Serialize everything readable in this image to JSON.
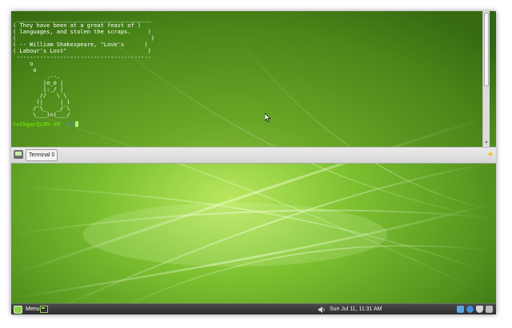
{
  "terminal": {
    "fortune_lines": [
      " ________________________________________",
      "( They have been at a great feast of )",
      "( languages, and stolen the scraps.     )",
      "(                                        )",
      "( -- William Shakespeare, \"Love's      )",
      "( Labour's Lost\"                        )",
      " ----------------------------------------",
      "     o",
      "      o",
      "          .--.",
      "         |o_o |",
      "         |:_/ |",
      "        //   \\ \\",
      "       (|     | )",
      "      /'\\_   _/`\\",
      "      \\___)=(___/"
    ],
    "prompt_user": "rothgar@LM9-VM",
    "prompt_path": " ~ $"
  },
  "tabbar": {
    "tab_label": "Terminal 0"
  },
  "panel": {
    "menu_label": "Menu",
    "clock": "Sun Jul 11, 11:31 AM"
  },
  "icons": {
    "menu": "mint-logo-icon",
    "terminal": "terminal-icon",
    "volume": "volume-icon",
    "network": "network-icon",
    "update": "update-manager-icon",
    "shield": "shield-icon",
    "desktop": "show-desktop-icon"
  },
  "colors": {
    "wallpaper_green": "#5fa321",
    "prompt_green": "#6fd600",
    "prompt_blue": "#3a7bd5",
    "panel_dark": "#2a2a2a"
  }
}
